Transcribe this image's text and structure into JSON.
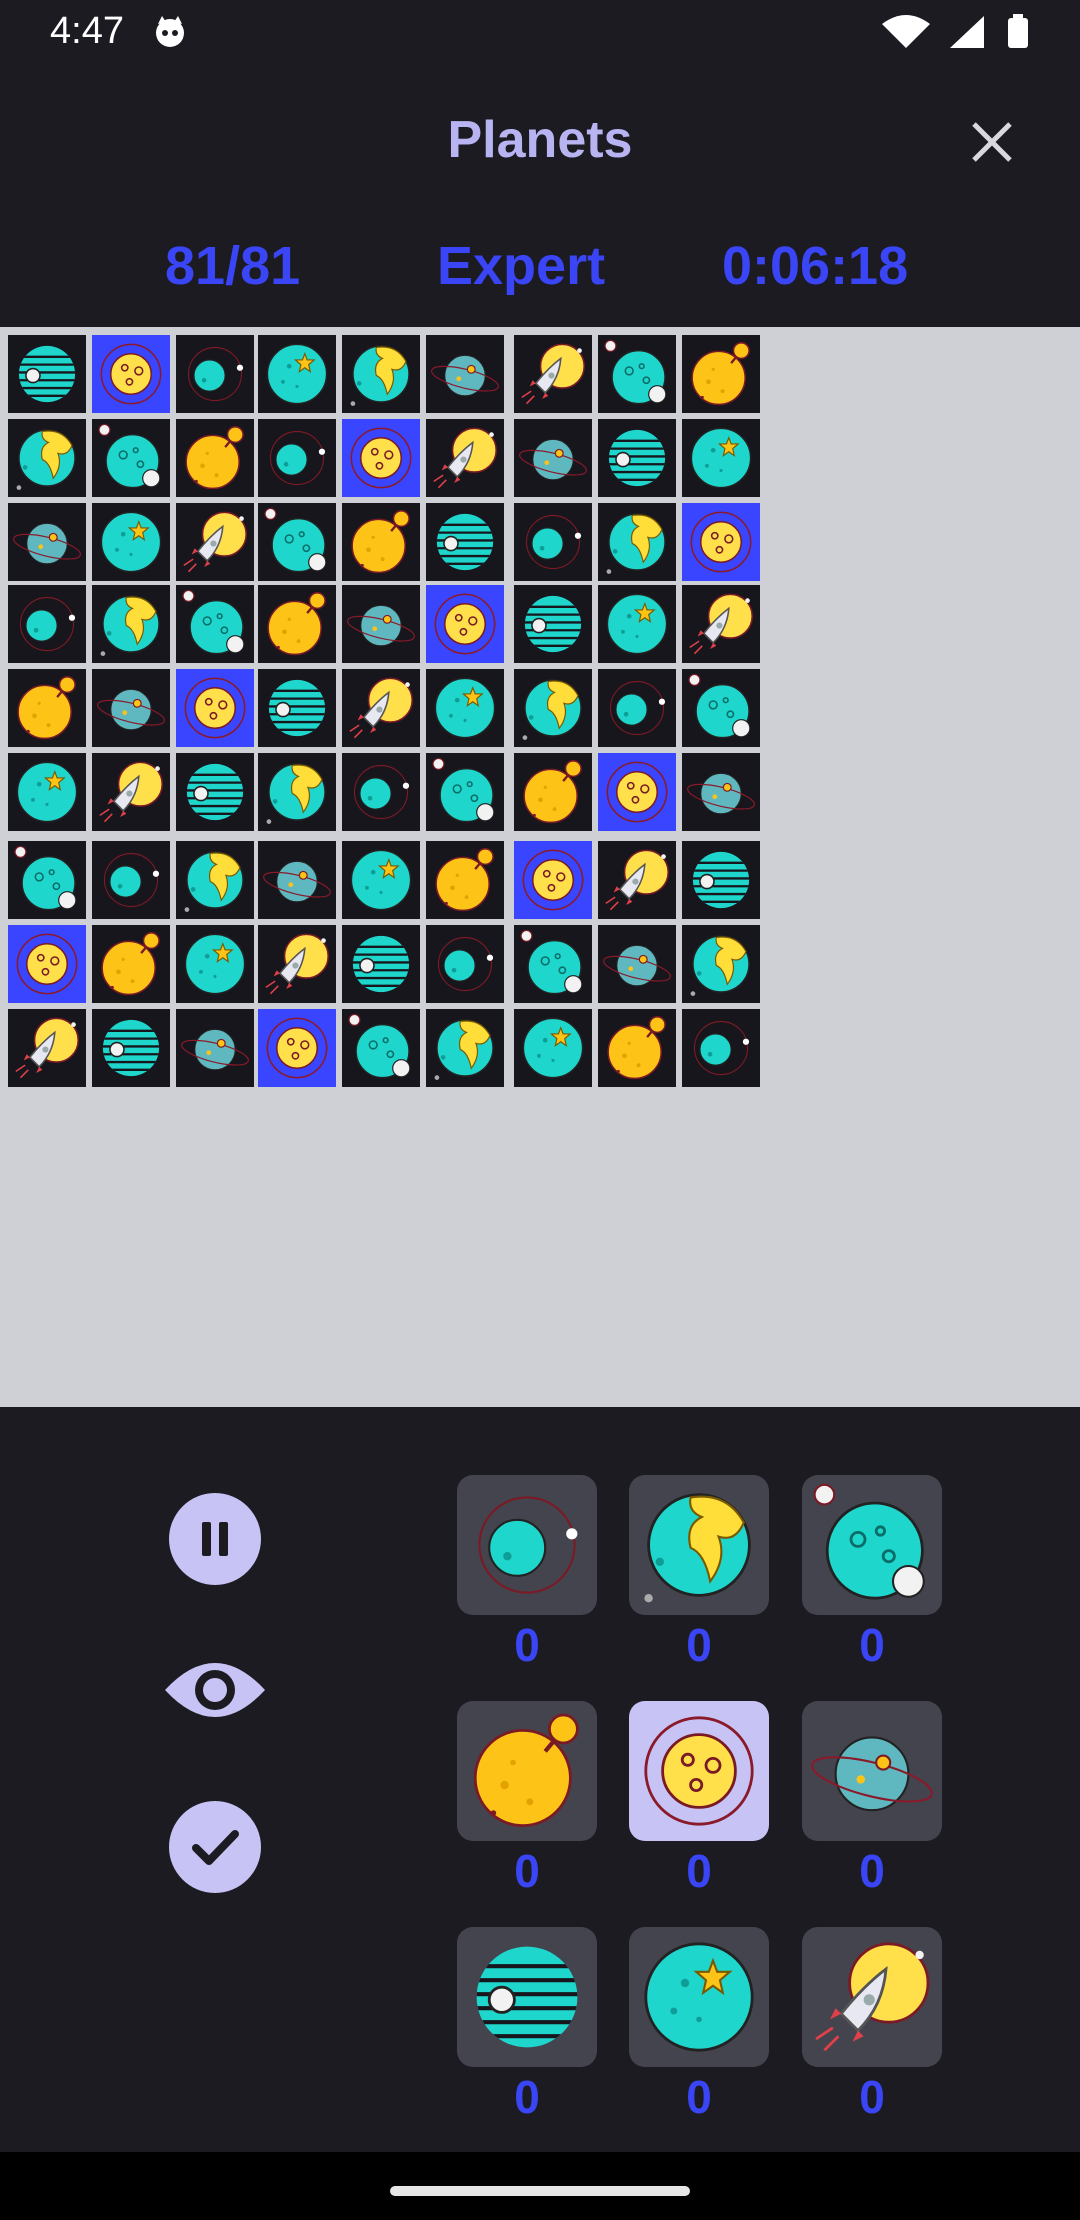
{
  "status": {
    "time": "4:47"
  },
  "header": {
    "title": "Planets",
    "close_icon": "close-icon"
  },
  "stats": {
    "progress": "81/81",
    "difficulty": "Expert",
    "timer": "0:06:18"
  },
  "colors": {
    "accent": "#3a45f5",
    "title": "#b8b4f2",
    "selected_cell": "#3a45ff",
    "background": "#1c1b22"
  },
  "board": {
    "rows": [
      [
        "striped",
        "moon",
        "ringed",
        "star",
        "earth",
        "saturn",
        "rocket",
        "crater",
        "sun"
      ],
      [
        "earth",
        "crater",
        "sun",
        "ringed",
        "moon",
        "rocket",
        "saturn",
        "striped",
        "star"
      ],
      [
        "saturn",
        "star",
        "rocket",
        "crater",
        "sun",
        "striped",
        "ringed",
        "earth",
        "moon"
      ],
      [
        "ringed",
        "earth",
        "crater",
        "sun",
        "saturn",
        "moon",
        "striped",
        "star",
        "rocket"
      ],
      [
        "sun",
        "saturn",
        "moon",
        "striped",
        "rocket",
        "star",
        "earth",
        "ringed",
        "crater"
      ],
      [
        "star",
        "rocket",
        "striped",
        "earth",
        "ringed",
        "crater",
        "sun",
        "moon",
        "saturn"
      ],
      [
        "crater",
        "ringed",
        "earth",
        "saturn",
        "star",
        "sun",
        "moon",
        "rocket",
        "striped"
      ],
      [
        "moon",
        "sun",
        "star",
        "rocket",
        "striped",
        "ringed",
        "crater",
        "saturn",
        "earth"
      ],
      [
        "rocket",
        "striped",
        "saturn",
        "moon",
        "crater",
        "earth",
        "star",
        "sun",
        "ringed"
      ]
    ],
    "highlighted_piece": "moon"
  },
  "controls": [
    {
      "name": "pause-button",
      "icon": "pause-icon"
    },
    {
      "name": "reveal-button",
      "icon": "eye-icon"
    },
    {
      "name": "check-button",
      "icon": "check-icon"
    }
  ],
  "palette": [
    {
      "piece": "ringed",
      "count": "0"
    },
    {
      "piece": "earth",
      "count": "0"
    },
    {
      "piece": "crater",
      "count": "0"
    },
    {
      "piece": "sun",
      "count": "0"
    },
    {
      "piece": "moon",
      "count": "0",
      "active": true
    },
    {
      "piece": "saturn",
      "count": "0"
    },
    {
      "piece": "striped",
      "count": "0"
    },
    {
      "piece": "star",
      "count": "0"
    },
    {
      "piece": "rocket",
      "count": "0"
    }
  ]
}
